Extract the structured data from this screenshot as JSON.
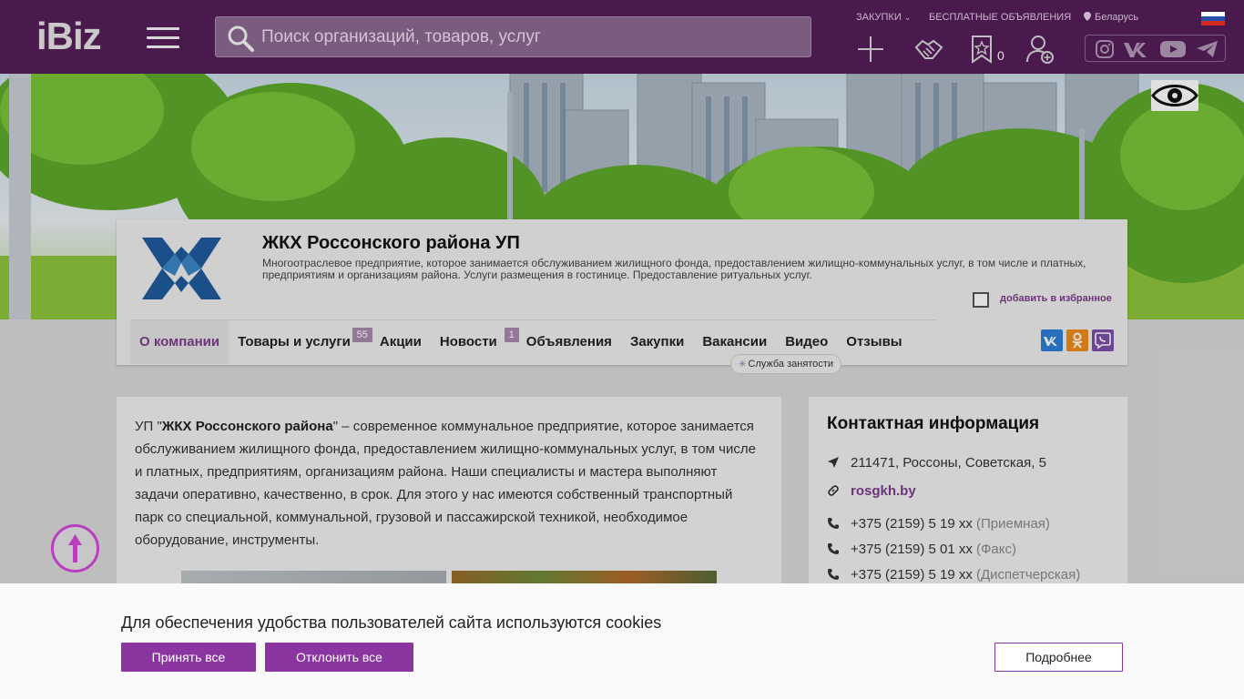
{
  "header": {
    "logo": "iBiz",
    "search_placeholder": "Поиск организаций, товаров, услуг",
    "nav": {
      "zakupki": "Закупки",
      "obyavleniya": "Бесплатные объявления",
      "region": "Беларусь"
    },
    "favorites_count": "0",
    "icons": [
      "plus-icon",
      "handshake-icon",
      "star-bookmark-icon",
      "add-user-icon"
    ],
    "social": [
      "instagram-icon",
      "vk-icon",
      "youtube-icon",
      "telegram-icon"
    ]
  },
  "company": {
    "name": "ЖКХ Россонского района УП",
    "description": "Многоотраслевое предприятие, которое занимается обслуживанием жилищного фонда, предоставлением жилищно-коммунальных услуг, в том числе и платных, предприятиям и организациям района. Услуги размещения в гостинице. Предоставление ритуальных услуг.",
    "add_favorite": "добавить в избранное",
    "tabs": [
      {
        "label": "О компании",
        "active": true
      },
      {
        "label": "Товары и услуги",
        "badge": "55"
      },
      {
        "label": "Акции"
      },
      {
        "label": "Новости",
        "badge": "1"
      },
      {
        "label": "Объявления"
      },
      {
        "label": "Закупки"
      },
      {
        "label": "Вакансии"
      },
      {
        "label": "Видео"
      },
      {
        "label": "Отзывы"
      }
    ],
    "sub_tag": "Служба занятости",
    "share": {
      "vk": "ВК",
      "ok": "ОК",
      "viber": "Vb"
    }
  },
  "about": {
    "prefix": "УП \"",
    "name_bold": "ЖКХ Россонского района",
    "text": "\" – современное коммунальное предприятие, которое занимается обслуживанием жилищного фонда, предоставлением жилищно-коммунальных услуг, в том числе и платных, предприятиям, организациям района. Наши специалисты и мастера выполняют задачи оперативно, качественно, в срок. Для этого у нас имеются собственный транспортный парк со специальной, коммунальной, грузовой и пассажирской техникой, необходимое оборудование, инструменты."
  },
  "contacts": {
    "title": "Контактная информация",
    "address": "211471, Россоны, Советская, 5",
    "website": "rosgkh.by",
    "phones": [
      {
        "number": "+375 (2159) 5 19 xx",
        "note": "(Приемная)"
      },
      {
        "number": "+375 (2159) 5 01 xx",
        "note": "(Факс)"
      },
      {
        "number": "+375 (2159) 5 19 xx",
        "note": "(Диспетчерская)"
      }
    ]
  },
  "cookie": {
    "text": "Для обеспечения удобства пользователей сайта используются cookies",
    "accept": "Принять все",
    "reject": "Отклонить все",
    "more": "Подробнее"
  },
  "colors": {
    "header_bg": "#4a1a4f",
    "accent": "#8a35a0",
    "link": "#7b3d8a"
  }
}
